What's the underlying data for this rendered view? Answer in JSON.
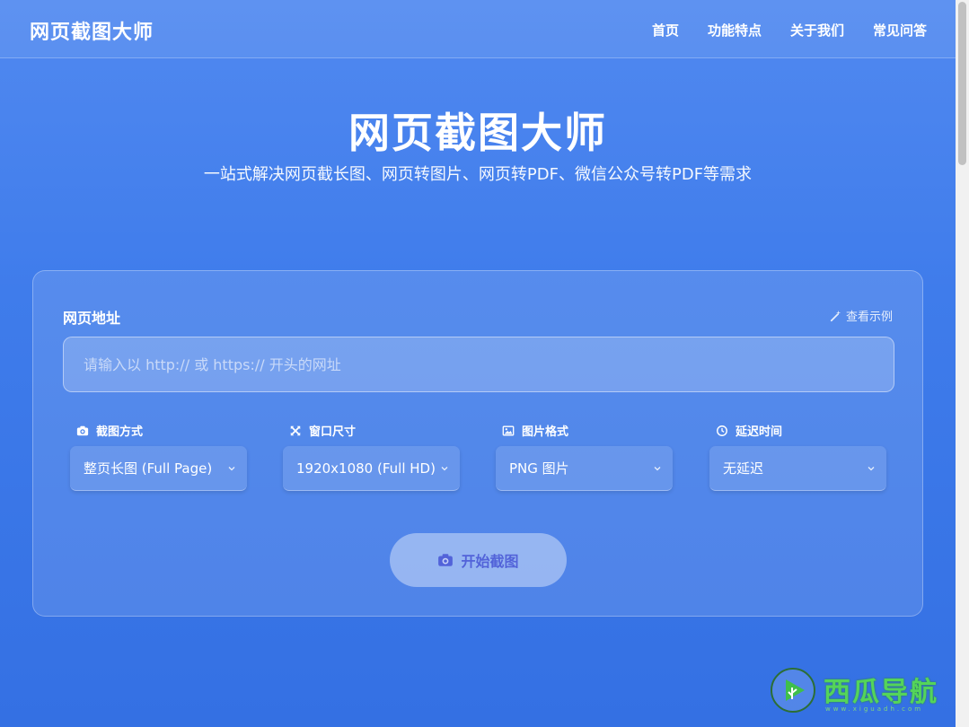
{
  "header": {
    "brand": "网页截图大师",
    "nav": [
      "首页",
      "功能特点",
      "关于我们",
      "常见问答"
    ]
  },
  "hero": {
    "title": "网页截图大师",
    "subtitle": "一站式解决网页截长图、网页转图片、网页转PDF、微信公众号转PDF等需求"
  },
  "form": {
    "url_label": "网页地址",
    "example_label": "查看示例",
    "url_placeholder": "请输入以 http:// 或 https:// 开头的网址",
    "options": [
      {
        "label": "截图方式",
        "value": "整页长图 (Full Page)",
        "icon": "camera-icon"
      },
      {
        "label": "窗口尺寸",
        "value": "1920x1080 (Full HD)",
        "icon": "expand-icon"
      },
      {
        "label": "图片格式",
        "value": "PNG 图片",
        "icon": "image-icon"
      },
      {
        "label": "延迟时间",
        "value": "无延迟",
        "icon": "clock-icon"
      }
    ],
    "submit_label": "开始截图"
  },
  "watermark": {
    "text": "西瓜导航",
    "sub": "www.xiguadh.com"
  },
  "colors": {
    "background": "#3f7ceb",
    "button_text": "#5263d9",
    "watermark": "#54d45a"
  }
}
